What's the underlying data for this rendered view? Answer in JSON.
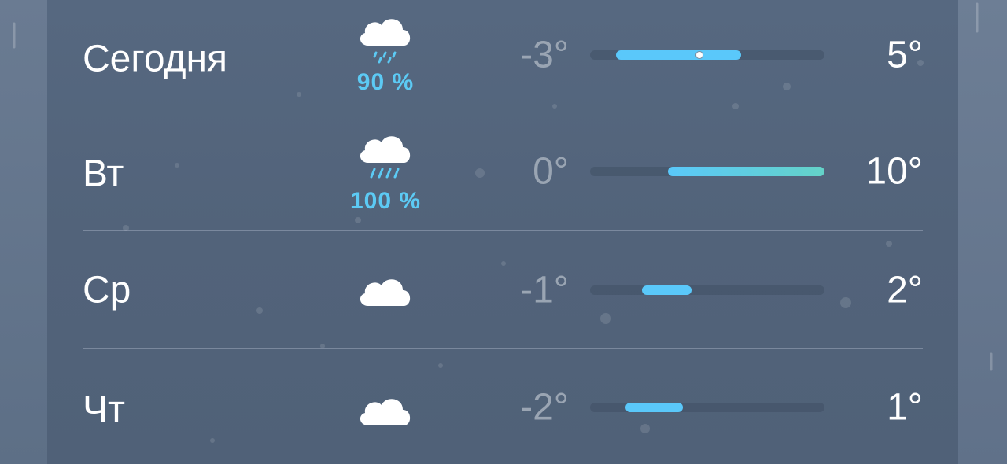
{
  "forecast": {
    "days": [
      {
        "day": "Сегодня",
        "icon": "cloud-rain-icon",
        "precip": "90 %",
        "low": "-3°",
        "high": "5°",
        "low_value": -3,
        "high_value": 5,
        "current_value": 2
      },
      {
        "day": "Вт",
        "icon": "cloud-heavy-rain-icon",
        "precip": "100 %",
        "low": "0°",
        "high": "10°",
        "low_value": 0,
        "high_value": 10
      },
      {
        "day": "Ср",
        "icon": "cloud-icon",
        "low": "-1°",
        "high": "2°",
        "low_value": -1,
        "high_value": 2
      },
      {
        "day": "Чт",
        "icon": "cloud-icon",
        "low": "-2°",
        "high": "1°",
        "low_value": -2,
        "high_value": 1
      }
    ]
  },
  "colors": {
    "precip_text": "#5ccaf4",
    "bar_cool": "#5ac8fa",
    "bar_warm": "#64d2c8"
  }
}
